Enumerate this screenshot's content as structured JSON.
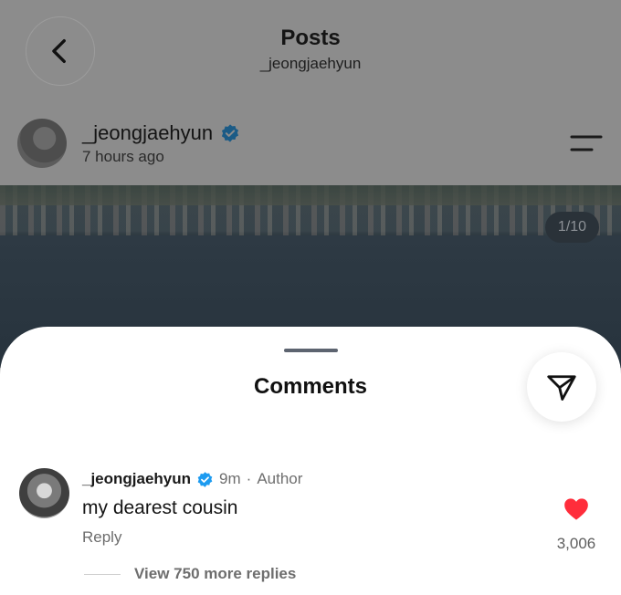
{
  "header": {
    "title": "Posts",
    "subtitle": "_jeongjaehyun"
  },
  "post": {
    "username": "_jeongjaehyun",
    "time": "7 hours ago",
    "photo_counter": "1/10"
  },
  "comments_sheet": {
    "title": "Comments",
    "comment": {
      "username": "_jeongjaehyun",
      "time": "9m",
      "separator": "·",
      "author_tag": "Author",
      "text": "my dearest cousin",
      "reply_label": "Reply",
      "likes": "3,006",
      "view_more": "View 750 more replies"
    }
  },
  "colors": {
    "verified": "#1d9bf0",
    "heart": "#ff2d3b",
    "dim_overlay": "#8c8c8c"
  },
  "icons": {
    "back": "chevron-left-icon",
    "menu": "menu-icon",
    "verified": "verified-badge-icon",
    "share": "send-icon",
    "like": "heart-icon"
  }
}
